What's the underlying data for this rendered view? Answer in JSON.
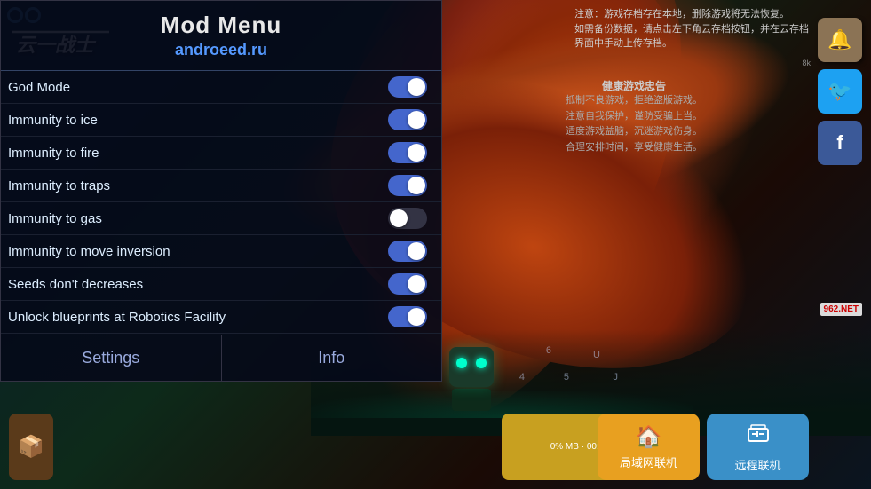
{
  "app": {
    "title": "Mod Menu",
    "subtitle": "androeed.ru"
  },
  "notice": {
    "line1": "注意：游戏存档存在本地，删除游戏将无法恢复。",
    "line2": "如需备份数据，请点击左下角云存档按钮，并在云存档",
    "line3": "界面中手动上传存档。",
    "small": "8k"
  },
  "health_warning": {
    "title": "健康游戏忠告",
    "line1": "抵制不良游戏，拒绝盗版游戏。",
    "line2": "注意自我保护，谨防受骗上当。",
    "line3": "适度游戏益脑，沉迷游戏伤身。",
    "line4": "合理安排时间，享受健康生活。"
  },
  "mod_items": [
    {
      "label": "God Mode",
      "state": "on"
    },
    {
      "label": "Immunity to ice",
      "state": "on"
    },
    {
      "label": "Immunity to fire",
      "state": "on"
    },
    {
      "label": "Immunity to traps",
      "state": "on"
    },
    {
      "label": "Immunity to gas",
      "state": "off"
    },
    {
      "label": "Immunity to move inversion",
      "state": "on"
    },
    {
      "label": "Seeds don't decreases",
      "state": "on"
    },
    {
      "label": "Unlock blueprints at Robotics Facility",
      "state": "on"
    }
  ],
  "tabs": {
    "settings": "Settings",
    "info": "Info"
  },
  "bottom_buttons": {
    "local": "局域网联机",
    "remote": "远程联机"
  },
  "watermark": "962.NET",
  "ee_logo": "ee"
}
